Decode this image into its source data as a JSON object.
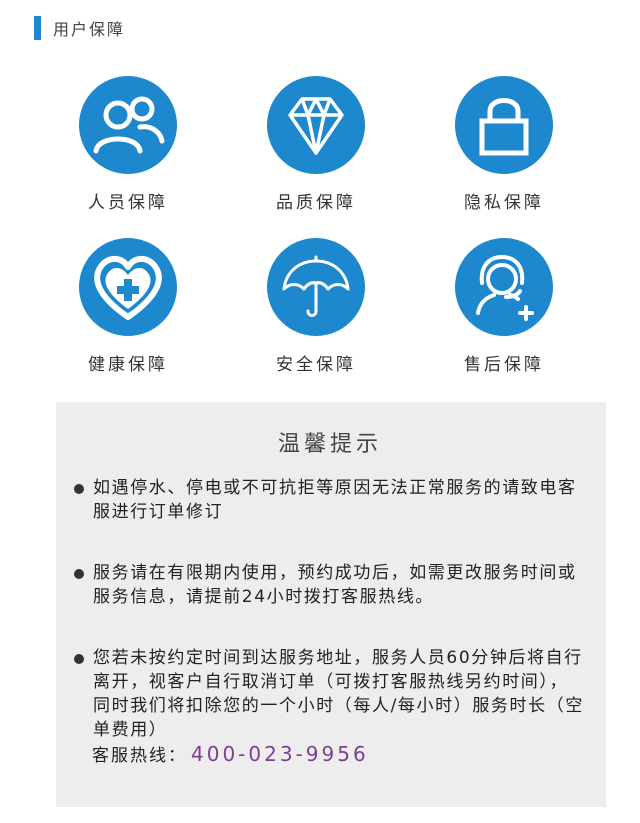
{
  "header": {
    "title": "用户保障"
  },
  "guarantees": [
    {
      "label": "人员保障",
      "icon": "people-icon"
    },
    {
      "label": "品质保障",
      "icon": "diamond-icon"
    },
    {
      "label": "隐私保障",
      "icon": "lock-icon"
    },
    {
      "label": "健康保障",
      "icon": "heart-medical-icon"
    },
    {
      "label": "安全保障",
      "icon": "umbrella-icon"
    },
    {
      "label": "售后保障",
      "icon": "headset-support-icon"
    }
  ],
  "notice": {
    "title": "温馨提示",
    "items": [
      "如遇停水、停电或不可抗拒等原因无法正常服务的请致电客服进行订单修订",
      "服务请在有限期内使用，预约成功后，如需更改服务时间或服务信息，请提前24小时拨打客服热线。",
      "您若未按约定时间到达服务地址，服务人员60分钟后将自行离开，视客户自行取消订单（可拨打客服热线另约时间），同时我们将扣除您的一个小时（每人/每小时）服务时长（空单费用）"
    ],
    "hotline_label": "客服热线：",
    "hotline_number": "400-023-9956"
  },
  "colors": {
    "accent": "#1d88ce",
    "hotline": "#7b3f96",
    "panel": "#ededed"
  }
}
